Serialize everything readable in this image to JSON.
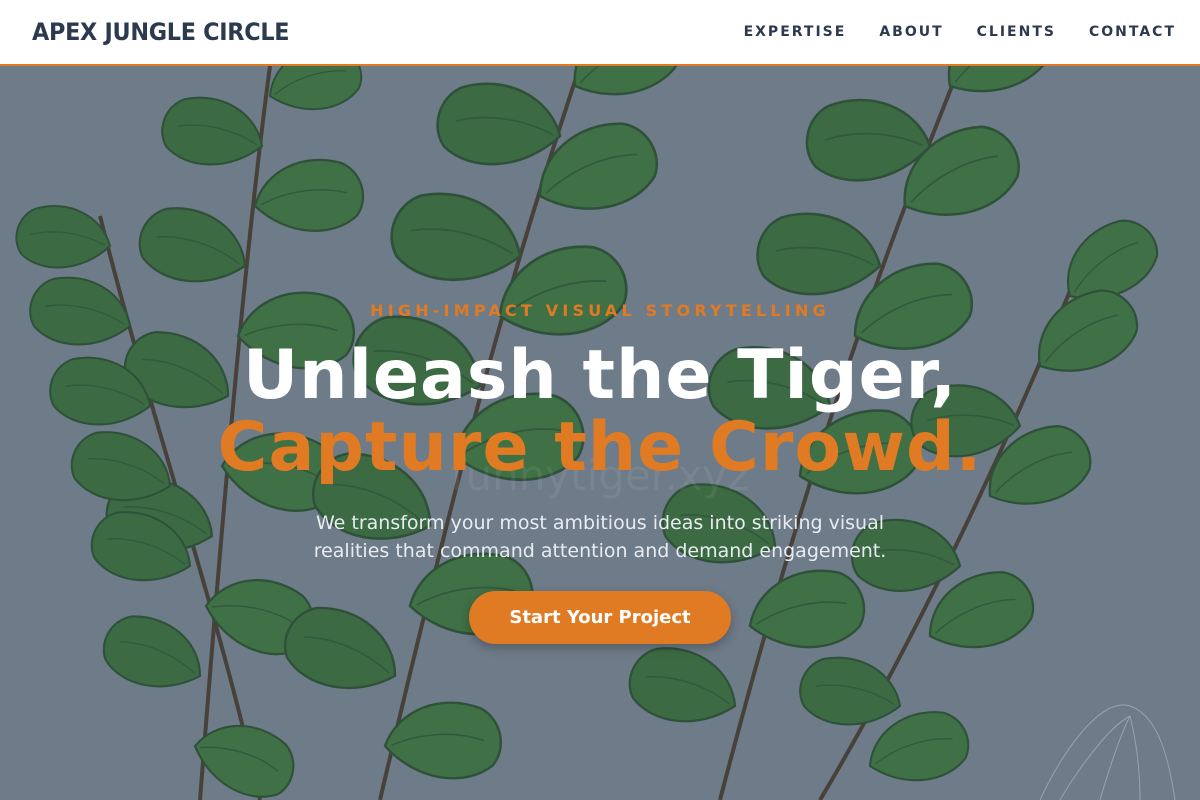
{
  "header": {
    "brand": "APEX JUNGLE CIRCLE",
    "nav": [
      {
        "label": "EXPERTISE"
      },
      {
        "label": "ABOUT"
      },
      {
        "label": "CLIENTS"
      },
      {
        "label": "CONTACT"
      }
    ]
  },
  "hero": {
    "eyebrow": "HIGH-IMPACT VISUAL STORYTELLING",
    "headline_line1": "Unleash the Tiger,",
    "headline_line2": "Capture the Crowd.",
    "subtext": "We transform your most ambitious ideas into striking visual realities that command attention and demand engagement.",
    "cta_label": "Start Your Project",
    "background_image": "fern-leaves-illustration",
    "watermark": "funnytiger.xyz"
  },
  "colors": {
    "accent": "#e07b24",
    "brand_text": "#2b3a4f",
    "header_bg": "#ffffff",
    "hero_bg": "#7d8894"
  }
}
